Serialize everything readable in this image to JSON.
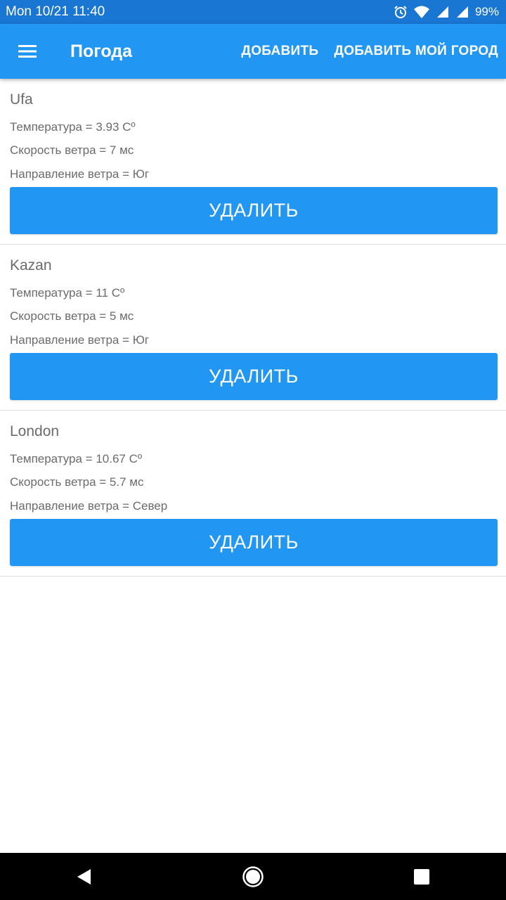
{
  "status_bar": {
    "datetime": "Mon 10/21 11:40",
    "battery": "99%",
    "icons": [
      "alarm-icon",
      "wifi-icon",
      "signal-icon",
      "signal-icon"
    ]
  },
  "app_bar": {
    "title": "Погода",
    "action_add": "ДОБАВИТЬ",
    "action_add_my_city": "ДОБАВИТЬ МОЙ ГОРОД",
    "menu_icon": "hamburger-menu-icon"
  },
  "cities": [
    {
      "name": "Ufa",
      "temperature": "Температура = 3.93 Cº",
      "wind_speed": "Скорость ветра = 7 мс",
      "wind_direction": "Направление ветра = Юг",
      "delete_label": "УДАЛИТЬ"
    },
    {
      "name": "Kazan",
      "temperature": "Температура = 11 Cº",
      "wind_speed": "Скорость ветра = 5 мс",
      "wind_direction": "Направление ветра = Юг",
      "delete_label": "УДАЛИТЬ"
    },
    {
      "name": "London",
      "temperature": "Температура = 10.67 Cº",
      "wind_speed": "Скорость ветра = 5.7 мс",
      "wind_direction": "Направление ветра = Север",
      "delete_label": "УДАЛИТЬ"
    }
  ],
  "nav_bar": {
    "icons": [
      "back-icon",
      "home-icon",
      "recents-icon"
    ]
  },
  "colors": {
    "status_bar": "#1976D2",
    "primary": "#2196F3",
    "text_secondary": "#6b6b6b",
    "nav_bar": "#000000"
  }
}
